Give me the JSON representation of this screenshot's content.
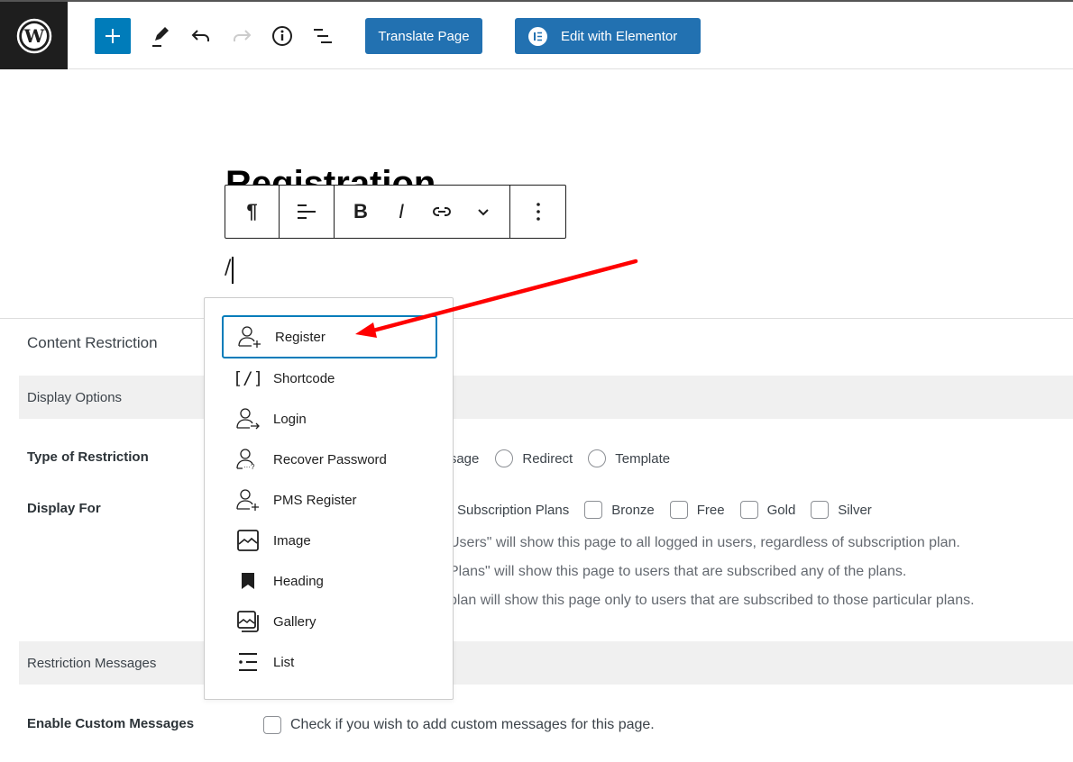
{
  "topbar": {
    "logo": "wordpress-logo",
    "add_block_label": "+",
    "translate_label": "Translate Page",
    "elementor_label": "Edit with Elementor"
  },
  "editor": {
    "title": "Registration",
    "typed_text": "/",
    "block_toolbar": {
      "paragraph": "¶",
      "bold": "B",
      "italic": "I"
    }
  },
  "inserter": {
    "items": [
      {
        "label": "Register",
        "icon": "user-plus-icon",
        "active": true
      },
      {
        "label": "Shortcode",
        "icon": "shortcode-icon"
      },
      {
        "label": "Login",
        "icon": "user-login-icon"
      },
      {
        "label": "Recover Password",
        "icon": "user-password-icon"
      },
      {
        "label": "PMS Register",
        "icon": "user-plus-icon"
      },
      {
        "label": "Image",
        "icon": "image-icon"
      },
      {
        "label": "Heading",
        "icon": "bookmark-icon"
      },
      {
        "label": "Gallery",
        "icon": "gallery-icon"
      },
      {
        "label": "List",
        "icon": "list-icon"
      }
    ]
  },
  "meta": {
    "title": "Content Restriction",
    "display_options": "Display Options",
    "type_label": "Type of Restriction",
    "type_options": [
      "essage",
      "Redirect",
      "Template"
    ],
    "display_for_label": "Display For",
    "display_for_options": [
      "Subscription Plans",
      "Bronze",
      "Free",
      "Gold",
      "Silver"
    ],
    "help_lines": [
      "Users\" will show this page to all logged in users, regardless of subscription plan.",
      "Plans\" will show this page to users that are subscribed any of the plans.",
      "plan will show this page only to users that are subscribed to those particular plans."
    ],
    "restriction_messages": "Restriction Messages",
    "custom_messages_label": "Enable Custom Messages",
    "custom_messages_text": "Check if you wish to add custom messages for this page."
  },
  "colors": {
    "primary_blue": "#007cba",
    "button_blue": "#2271b1",
    "annotation_red": "#ff0000"
  }
}
